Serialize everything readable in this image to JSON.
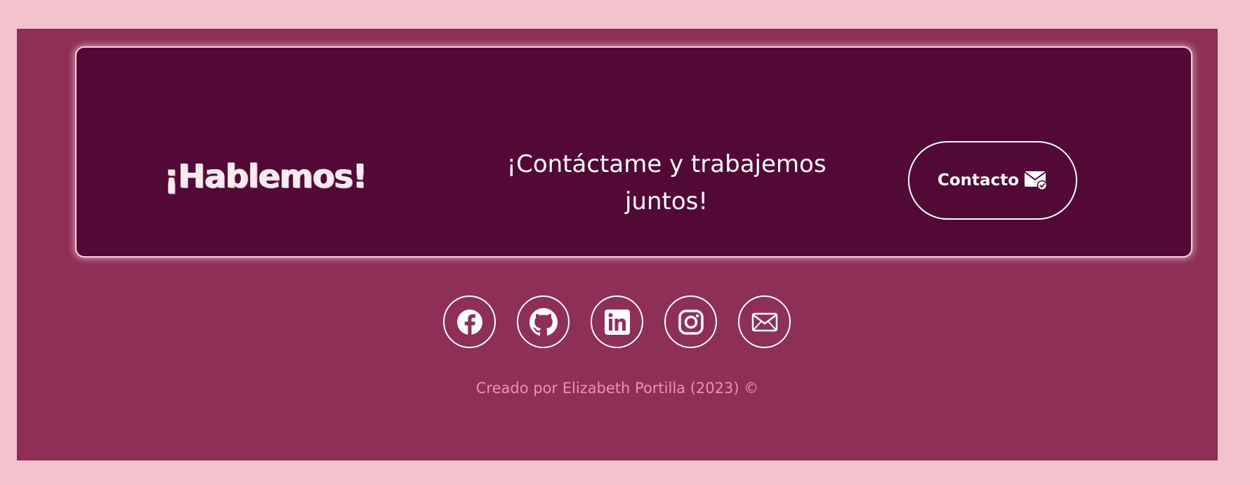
{
  "cta": {
    "title": "¡Hablemos!",
    "text": "¡Contáctame y trabajemos juntos!",
    "button_label": "Contacto",
    "button_icon": "envelope-check-icon"
  },
  "socials": [
    {
      "name": "Facebook",
      "icon": "facebook-icon"
    },
    {
      "name": "GitHub",
      "icon": "github-icon"
    },
    {
      "name": "LinkedIn",
      "icon": "linkedin-icon"
    },
    {
      "name": "Instagram",
      "icon": "instagram-icon"
    },
    {
      "name": "Email",
      "icon": "envelope-icon"
    }
  ],
  "credit": "Creado por Elizabeth Portilla (2023) ©",
  "colors": {
    "page_background": "#f2c3cd",
    "footer_background": "#8e2f55",
    "card_background": "#520935",
    "credit_text": "#f48bbb",
    "foreground": "#ffffff"
  }
}
